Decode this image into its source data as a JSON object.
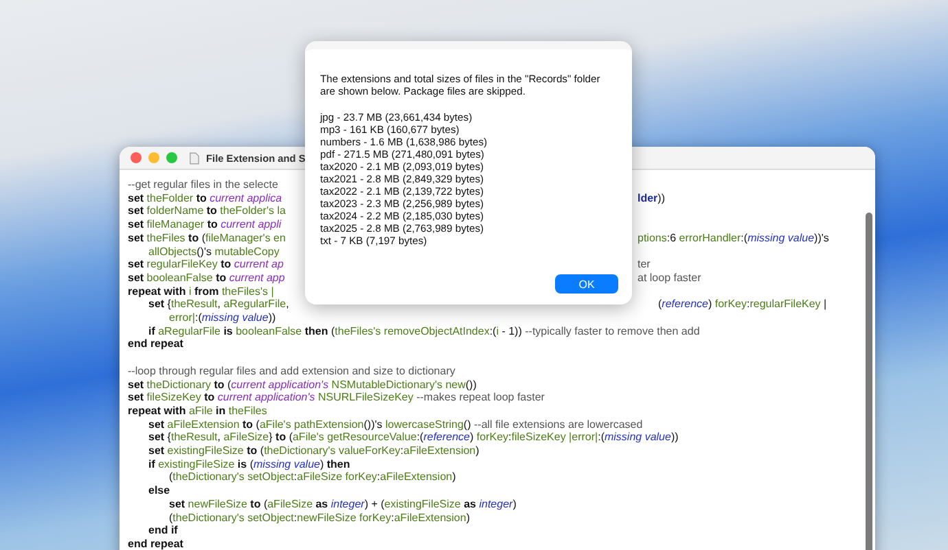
{
  "editor_window": {
    "title": "File Extension and S",
    "code_blocks": [
      {
        "lines": [
          {
            "segments": [
              {
                "kind": "comment",
                "text": "--get regular files in the selecte"
              }
            ]
          },
          {
            "segments": [
              {
                "kind": "keyword",
                "text": "set "
              },
              {
                "kind": "variable",
                "text": "theFolder "
              },
              {
                "kind": "keyword",
                "text": "to "
              },
              {
                "kind": "application",
                "text": "current applica"
              }
            ],
            "right_segments": [
              {
                "kind": "class",
                "text": "lder"
              },
              {
                "kind": "plain",
                "text": "))"
              }
            ]
          },
          {
            "segments": [
              {
                "kind": "keyword",
                "text": "set "
              },
              {
                "kind": "variable",
                "text": "folderName "
              },
              {
                "kind": "keyword",
                "text": "to "
              },
              {
                "kind": "variable",
                "text": "theFolder's la"
              }
            ]
          },
          {
            "segments": [
              {
                "kind": "keyword",
                "text": "set "
              },
              {
                "kind": "variable",
                "text": "fileManager "
              },
              {
                "kind": "keyword",
                "text": "to "
              },
              {
                "kind": "application",
                "text": "current appli"
              }
            ]
          },
          {
            "segments": [
              {
                "kind": "keyword",
                "text": "set "
              },
              {
                "kind": "variable",
                "text": "theFiles "
              },
              {
                "kind": "keyword",
                "text": "to "
              },
              {
                "kind": "plain",
                "text": "("
              },
              {
                "kind": "variable",
                "text": "fileManager's en"
              }
            ],
            "right_segments": [
              {
                "kind": "variable",
                "text": "ptions"
              },
              {
                "kind": "plain",
                "text": ":6 "
              },
              {
                "kind": "variable",
                "text": "errorHandler"
              },
              {
                "kind": "plain",
                "text": ":("
              },
              {
                "kind": "constant",
                "text": "missing value"
              },
              {
                "kind": "plain",
                "text": "))'s"
              }
            ],
            "children": [
              {
                "segments": [
                  {
                    "kind": "variable",
                    "text": "allObjects"
                  },
                  {
                    "kind": "plain",
                    "text": "()'s "
                  },
                  {
                    "kind": "variable",
                    "text": "mutableCopy"
                  }
                ]
              }
            ]
          },
          {
            "segments": [
              {
                "kind": "keyword",
                "text": "set "
              },
              {
                "kind": "variable",
                "text": "regularFileKey "
              },
              {
                "kind": "keyword",
                "text": "to "
              },
              {
                "kind": "application",
                "text": "current ap"
              }
            ],
            "right_segments": [
              {
                "kind": "comment",
                "text": "ter"
              }
            ]
          },
          {
            "segments": [
              {
                "kind": "keyword",
                "text": "set "
              },
              {
                "kind": "variable",
                "text": "booleanFalse "
              },
              {
                "kind": "keyword",
                "text": "to "
              },
              {
                "kind": "application",
                "text": "current app"
              }
            ],
            "right_segments": [
              {
                "kind": "comment",
                "text": "at loop faster"
              }
            ]
          },
          {
            "segments": [
              {
                "kind": "keyword",
                "text": "repeat with "
              },
              {
                "kind": "variable",
                "text": "i "
              },
              {
                "kind": "keyword",
                "text": "from "
              },
              {
                "kind": "variable",
                "text": "theFiles's |"
              }
            ],
            "children": [
              {
                "segments": [
                  {
                    "kind": "keyword",
                    "text": "set "
                  },
                  {
                    "kind": "plain",
                    "text": "{"
                  },
                  {
                    "kind": "variable",
                    "text": "theResult"
                  },
                  {
                    "kind": "plain",
                    "text": ", "
                  },
                  {
                    "kind": "variable",
                    "text": "aRegularFile"
                  },
                  {
                    "kind": "plain",
                    "text": ","
                  }
                ],
                "right_segments": [
                  {
                    "kind": "plain",
                    "text": "("
                  },
                  {
                    "kind": "constant",
                    "text": "reference"
                  },
                  {
                    "kind": "plain",
                    "text": ") "
                  },
                  {
                    "kind": "variable",
                    "text": "forKey"
                  },
                  {
                    "kind": "plain",
                    "text": ":"
                  },
                  {
                    "kind": "variable",
                    "text": "regularFileKey"
                  },
                  {
                    "kind": "plain",
                    "text": " |"
                  }
                ],
                "children": [
                  {
                    "segments": [
                      {
                        "kind": "variable",
                        "text": "error|"
                      },
                      {
                        "kind": "plain",
                        "text": ":("
                      },
                      {
                        "kind": "constant",
                        "text": "missing value"
                      },
                      {
                        "kind": "plain",
                        "text": "))"
                      }
                    ]
                  }
                ]
              },
              {
                "segments": [
                  {
                    "kind": "keyword",
                    "text": "if "
                  },
                  {
                    "kind": "variable",
                    "text": "aRegularFile "
                  },
                  {
                    "kind": "keyword",
                    "text": "is "
                  },
                  {
                    "kind": "variable",
                    "text": "booleanFalse "
                  },
                  {
                    "kind": "keyword",
                    "text": "then "
                  },
                  {
                    "kind": "plain",
                    "text": "("
                  },
                  {
                    "kind": "variable",
                    "text": "theFiles's removeObjectAtIndex"
                  },
                  {
                    "kind": "plain",
                    "text": ":("
                  },
                  {
                    "kind": "variable",
                    "text": "i"
                  },
                  {
                    "kind": "plain",
                    "text": " - 1)) "
                  },
                  {
                    "kind": "comment",
                    "text": "--typically faster to remove then add"
                  }
                ]
              }
            ]
          },
          {
            "segments": [
              {
                "kind": "keyword",
                "text": "end repeat"
              }
            ]
          }
        ]
      },
      {
        "lines": [
          {
            "segments": [
              {
                "kind": "comment",
                "text": "--loop through regular files and add extension and size to dictionary"
              }
            ]
          },
          {
            "segments": [
              {
                "kind": "keyword",
                "text": "set "
              },
              {
                "kind": "variable",
                "text": "theDictionary "
              },
              {
                "kind": "keyword",
                "text": "to "
              },
              {
                "kind": "plain",
                "text": "("
              },
              {
                "kind": "application",
                "text": "current application's "
              },
              {
                "kind": "variable",
                "text": "NSMutableDictionary's new"
              },
              {
                "kind": "plain",
                "text": "())"
              }
            ]
          },
          {
            "segments": [
              {
                "kind": "keyword",
                "text": "set "
              },
              {
                "kind": "variable",
                "text": "fileSizeKey "
              },
              {
                "kind": "keyword",
                "text": "to "
              },
              {
                "kind": "application",
                "text": "current application's "
              },
              {
                "kind": "variable",
                "text": "NSURLFileSizeKey "
              },
              {
                "kind": "comment",
                "text": "--makes repeat loop faster"
              }
            ]
          },
          {
            "segments": [
              {
                "kind": "keyword",
                "text": "repeat with "
              },
              {
                "kind": "variable",
                "text": "aFile "
              },
              {
                "kind": "keyword",
                "text": "in "
              },
              {
                "kind": "variable",
                "text": "theFiles"
              }
            ],
            "children": [
              {
                "segments": [
                  {
                    "kind": "keyword",
                    "text": "set "
                  },
                  {
                    "kind": "variable",
                    "text": "aFileExtension "
                  },
                  {
                    "kind": "keyword",
                    "text": "to "
                  },
                  {
                    "kind": "plain",
                    "text": "("
                  },
                  {
                    "kind": "variable",
                    "text": "aFile's pathExtension"
                  },
                  {
                    "kind": "plain",
                    "text": "())'s "
                  },
                  {
                    "kind": "variable",
                    "text": "lowercaseString"
                  },
                  {
                    "kind": "plain",
                    "text": "() "
                  },
                  {
                    "kind": "comment",
                    "text": "--all file extensions are lowercased"
                  }
                ]
              },
              {
                "segments": [
                  {
                    "kind": "keyword",
                    "text": "set "
                  },
                  {
                    "kind": "plain",
                    "text": "{"
                  },
                  {
                    "kind": "variable",
                    "text": "theResult"
                  },
                  {
                    "kind": "plain",
                    "text": ", "
                  },
                  {
                    "kind": "variable",
                    "text": "aFileSize"
                  },
                  {
                    "kind": "plain",
                    "text": "} "
                  },
                  {
                    "kind": "keyword",
                    "text": "to "
                  },
                  {
                    "kind": "plain",
                    "text": "("
                  },
                  {
                    "kind": "variable",
                    "text": "aFile's getResourceValue"
                  },
                  {
                    "kind": "plain",
                    "text": ":("
                  },
                  {
                    "kind": "constant",
                    "text": "reference"
                  },
                  {
                    "kind": "plain",
                    "text": ") "
                  },
                  {
                    "kind": "variable",
                    "text": "forKey"
                  },
                  {
                    "kind": "plain",
                    "text": ":"
                  },
                  {
                    "kind": "variable",
                    "text": "fileSizeKey |error|"
                  },
                  {
                    "kind": "plain",
                    "text": ":("
                  },
                  {
                    "kind": "constant",
                    "text": "missing value"
                  },
                  {
                    "kind": "plain",
                    "text": "))"
                  }
                ]
              },
              {
                "segments": [
                  {
                    "kind": "keyword",
                    "text": "set "
                  },
                  {
                    "kind": "variable",
                    "text": "existingFileSize "
                  },
                  {
                    "kind": "keyword",
                    "text": "to "
                  },
                  {
                    "kind": "plain",
                    "text": "("
                  },
                  {
                    "kind": "variable",
                    "text": "theDictionary's valueForKey"
                  },
                  {
                    "kind": "plain",
                    "text": ":"
                  },
                  {
                    "kind": "variable",
                    "text": "aFileExtension"
                  },
                  {
                    "kind": "plain",
                    "text": ")"
                  }
                ]
              },
              {
                "segments": [
                  {
                    "kind": "keyword",
                    "text": "if "
                  },
                  {
                    "kind": "variable",
                    "text": "existingFileSize "
                  },
                  {
                    "kind": "keyword",
                    "text": "is "
                  },
                  {
                    "kind": "plain",
                    "text": "("
                  },
                  {
                    "kind": "constant",
                    "text": "missing value"
                  },
                  {
                    "kind": "plain",
                    "text": ") "
                  },
                  {
                    "kind": "keyword",
                    "text": "then"
                  }
                ],
                "children": [
                  {
                    "segments": [
                      {
                        "kind": "plain",
                        "text": "("
                      },
                      {
                        "kind": "variable",
                        "text": "theDictionary's setObject"
                      },
                      {
                        "kind": "plain",
                        "text": ":"
                      },
                      {
                        "kind": "variable",
                        "text": "aFileSize forKey"
                      },
                      {
                        "kind": "plain",
                        "text": ":"
                      },
                      {
                        "kind": "variable",
                        "text": "aFileExtension"
                      },
                      {
                        "kind": "plain",
                        "text": ")"
                      }
                    ]
                  }
                ]
              },
              {
                "segments": [
                  {
                    "kind": "keyword",
                    "text": "else"
                  }
                ],
                "children": [
                  {
                    "segments": [
                      {
                        "kind": "keyword",
                        "text": "set "
                      },
                      {
                        "kind": "variable",
                        "text": "newFileSize "
                      },
                      {
                        "kind": "keyword",
                        "text": "to "
                      },
                      {
                        "kind": "plain",
                        "text": "("
                      },
                      {
                        "kind": "variable",
                        "text": "aFileSize "
                      },
                      {
                        "kind": "keyword",
                        "text": "as "
                      },
                      {
                        "kind": "constant",
                        "text": "integer"
                      },
                      {
                        "kind": "plain",
                        "text": ") + ("
                      },
                      {
                        "kind": "variable",
                        "text": "existingFileSize "
                      },
                      {
                        "kind": "keyword",
                        "text": "as "
                      },
                      {
                        "kind": "constant",
                        "text": "integer"
                      },
                      {
                        "kind": "plain",
                        "text": ")"
                      }
                    ]
                  },
                  {
                    "segments": [
                      {
                        "kind": "plain",
                        "text": "("
                      },
                      {
                        "kind": "variable",
                        "text": "theDictionary's setObject"
                      },
                      {
                        "kind": "plain",
                        "text": ":"
                      },
                      {
                        "kind": "variable",
                        "text": "newFileSize forKey"
                      },
                      {
                        "kind": "plain",
                        "text": ":"
                      },
                      {
                        "kind": "variable",
                        "text": "aFileExtension"
                      },
                      {
                        "kind": "plain",
                        "text": ")"
                      }
                    ]
                  }
                ]
              },
              {
                "segments": [
                  {
                    "kind": "keyword",
                    "text": "end if"
                  }
                ]
              }
            ]
          },
          {
            "segments": [
              {
                "kind": "keyword",
                "text": "end repeat"
              }
            ]
          }
        ]
      }
    ]
  },
  "dialog": {
    "message": "The extensions and total sizes of files in the \"Records\" folder are shown below. Package files are skipped.",
    "results": [
      "jpg - 23.7 MB (23,661,434 bytes)",
      "mp3 - 161 KB (160,677 bytes)",
      "numbers - 1.6 MB (1,638,986 bytes)",
      "pdf - 271.5 MB (271,480,091 bytes)",
      "tax2020 - 2.1 MB (2,093,019 bytes)",
      "tax2021 - 2.8 MB (2,849,329 bytes)",
      "tax2022 - 2.1 MB (2,139,722 bytes)",
      "tax2023 - 2.3 MB (2,256,989 bytes)",
      "tax2024 - 2.2 MB (2,185,030 bytes)",
      "tax2025 - 2.8 MB (2,763,989 bytes)",
      "txt - 7 KB (7,197 bytes)"
    ],
    "button": "OK"
  }
}
